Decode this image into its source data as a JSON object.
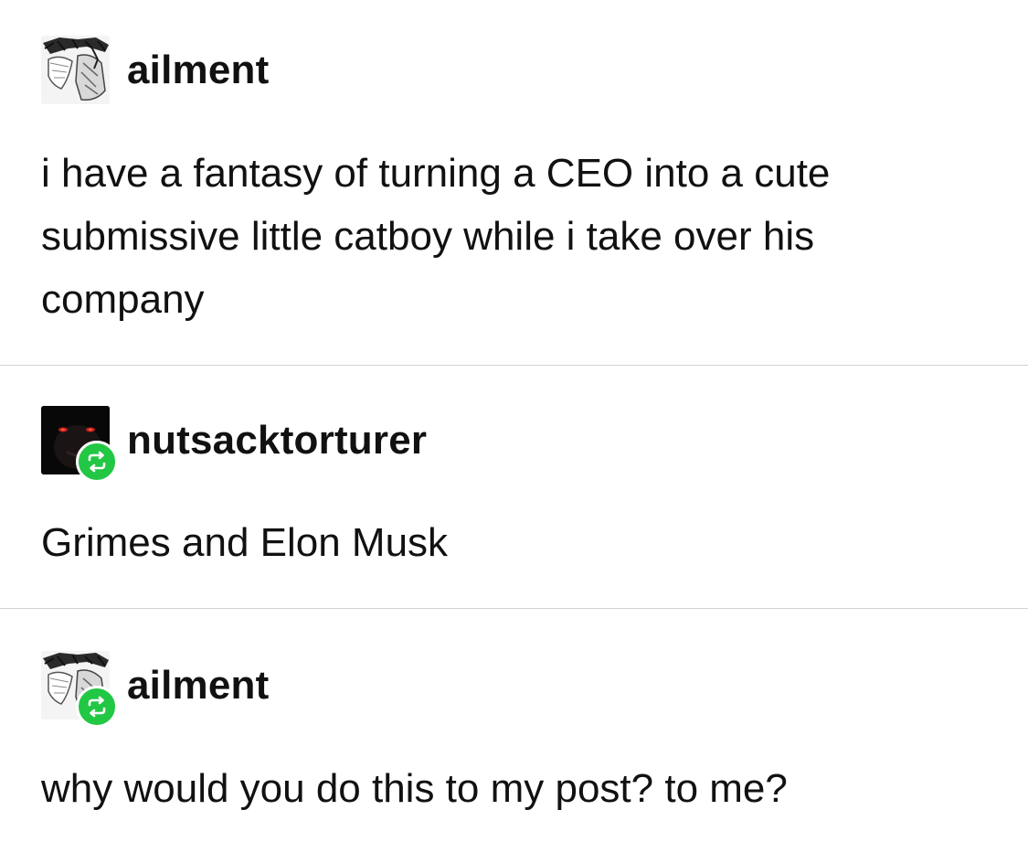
{
  "posts": [
    {
      "username": "ailment",
      "reblog": false,
      "text": "i have a fantasy of turning a CEO into a cute submissive little catboy while i take over his company"
    },
    {
      "username": "nutsacktorturer",
      "reblog": true,
      "text": "Grimes and Elon Musk"
    },
    {
      "username": "ailment",
      "reblog": true,
      "text": "why would you do this to my post? to me?"
    }
  ],
  "colors": {
    "reblog_badge": "#22c744",
    "divider": "#d2d2d2",
    "text": "#111111"
  },
  "icons": {
    "avatar_1": "manga-sketch-avatar",
    "avatar_2": "dark-red-eyes-avatar",
    "reblog": "reblog-icon"
  }
}
